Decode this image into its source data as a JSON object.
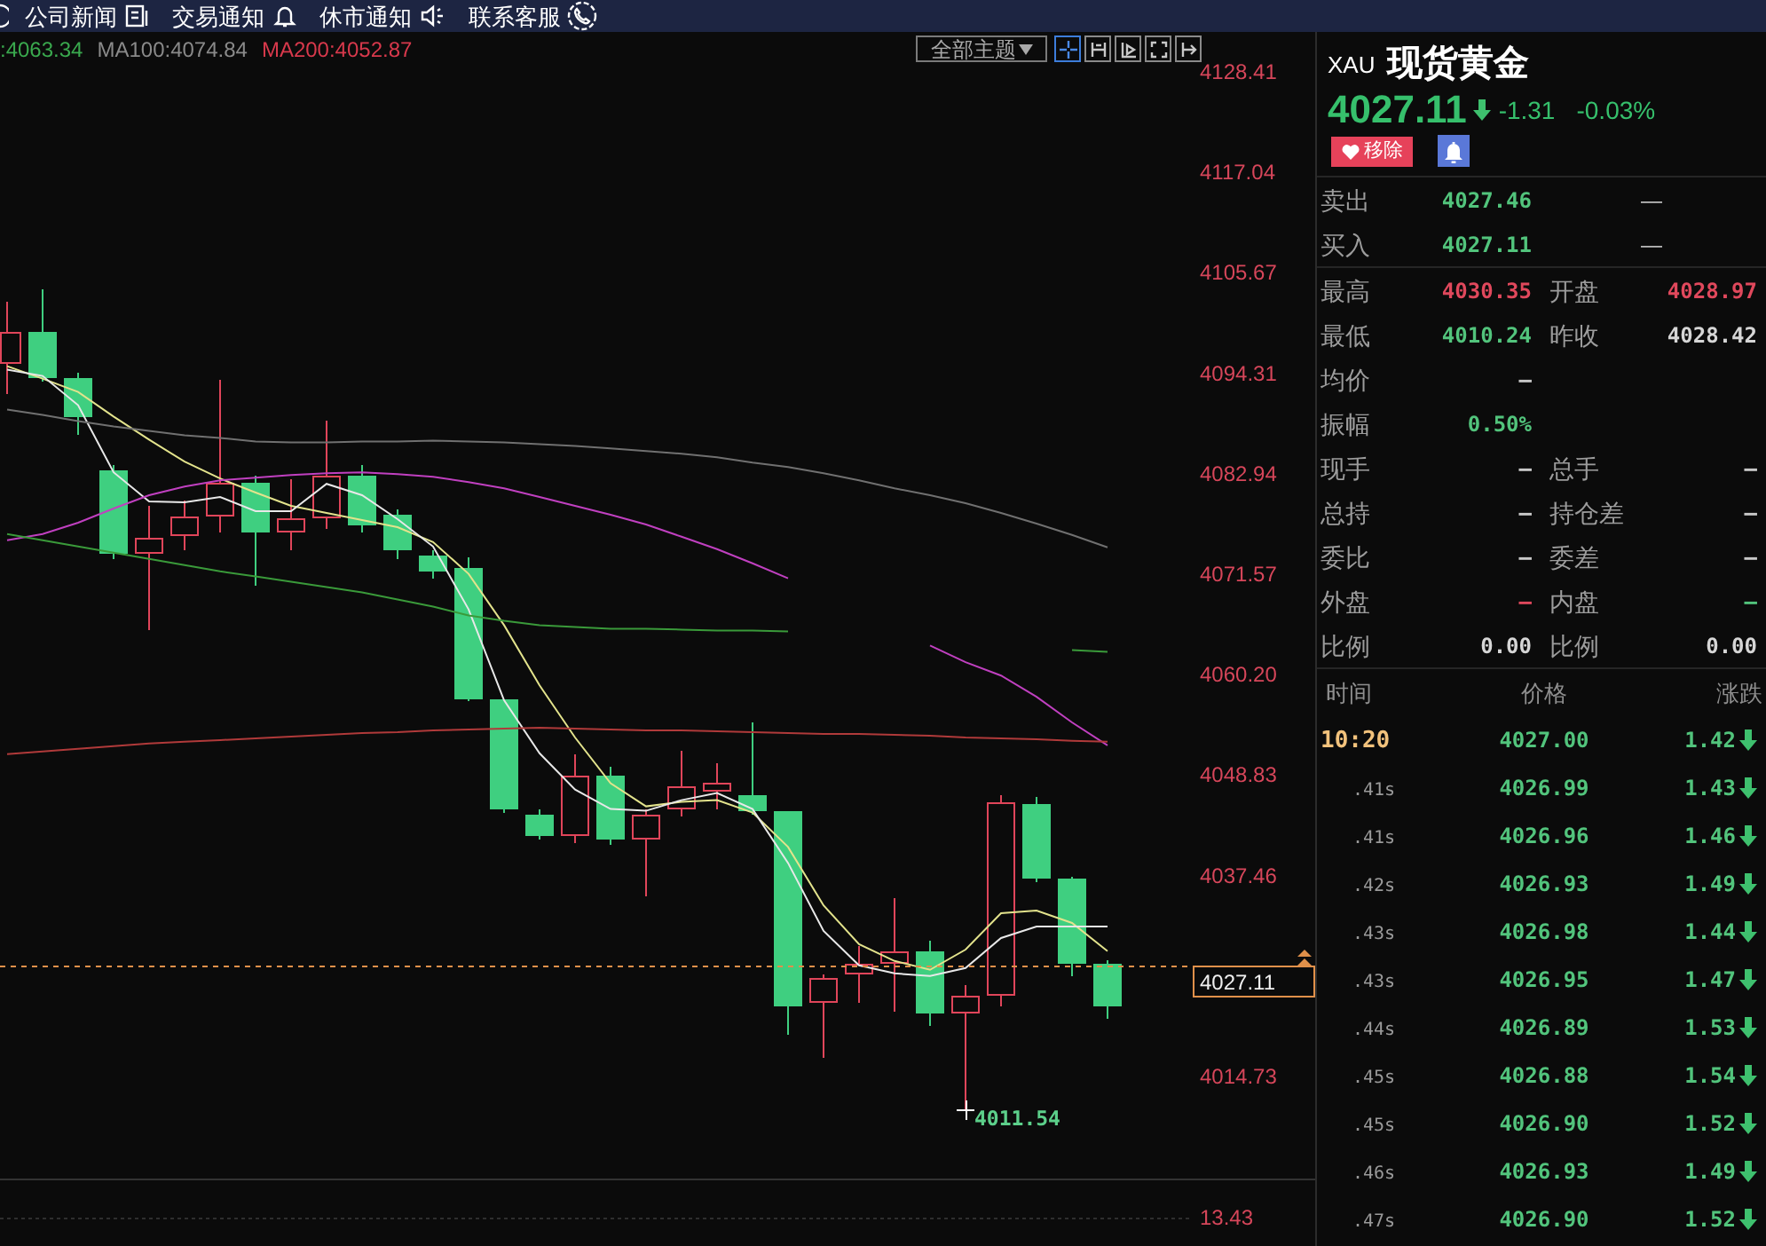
{
  "top_bar": {
    "items": [
      {
        "label": "公司新闻"
      },
      {
        "label": "交易通知"
      },
      {
        "label": "休市通知"
      },
      {
        "label": "联系客服"
      }
    ]
  },
  "chart": {
    "legend": [
      {
        "text": ":4063.34",
        "color": "#3aa94e"
      },
      {
        "text": "MA100:4074.84",
        "color": "#8a8a8a"
      },
      {
        "text": "MA200:4052.87",
        "color": "#d8394c"
      }
    ],
    "theme_select": {
      "value": "全部主题"
    },
    "tools": [
      {
        "kind": "crosshair",
        "selected": true
      },
      {
        "kind": "range",
        "selected": false
      },
      {
        "kind": "step",
        "selected": false
      },
      {
        "kind": "fullscreen",
        "selected": false
      },
      {
        "kind": "exit",
        "selected": false
      }
    ],
    "chart_data": {
      "type": "line",
      "ylim": [
        4014.73,
        4128.41
      ],
      "yticks": [
        4128.41,
        4117.04,
        4105.67,
        4094.31,
        4082.94,
        4071.57,
        {
          "value": 4060.2,
          "label": "4060.20"
        },
        4048.83,
        4037.46,
        4014.73
      ],
      "ref_lines": [
        {
          "axis": "y",
          "value": 4027.11,
          "label": "4027.11",
          "color": "#e0904a"
        }
      ],
      "series": [
        {
          "color": "#e3e38c",
          "values": [
            4095.0,
            4093.6,
            4092.1,
            4089.3,
            4086.7,
            4084.2,
            4082.3,
            4080.7,
            4079.2,
            4078.4,
            4077.6,
            4076.8,
            4075.1,
            4071.5,
            4065.7,
            4058.9,
            4053.0,
            4047.8,
            4045.2,
            4045.7,
            4045.9,
            4044.5,
            4040.6,
            4034.0,
            4029.6,
            4027.7,
            4026.7,
            4029.0,
            4033.1,
            4033.4,
            4032.0,
            4028.8
          ]
        },
        {
          "color": "#e8e8e8",
          "values": [
            4094.6,
            4093.9,
            4090.6,
            4083.0,
            4079.7,
            4079.6,
            4080.2,
            4078.6,
            4078.6,
            4081.7,
            4080.4,
            4077.7,
            4074.6,
            4067.5,
            4057.2,
            4051.2,
            4047.1,
            4044.9,
            4044.7,
            4045.9,
            4046.7,
            4044.9,
            4038.8,
            4031.1,
            4027.2,
            4026.3,
            4026.0,
            4026.9,
            4030.3,
            4031.6,
            4031.6,
            4031.6
          ]
        },
        {
          "color": "#c040c0",
          "values": [
            4075.3,
            4076.0,
            4077.3,
            4078.9,
            4080.4,
            4081.4,
            4082.1,
            4082.4,
            4082.7,
            4082.9,
            4083.0,
            4082.8,
            4082.5,
            4081.9,
            4081.2,
            4080.2,
            4079.2,
            4078.2,
            4077.1,
            4075.7,
            4074.3,
            4072.7,
            4071.0,
            null,
            null,
            null,
            4063.4,
            4061.5,
            4060.0,
            4057.6,
            4054.7,
            4052.1
          ]
        },
        {
          "color": "#3a9a3a",
          "values": [
            4076.0,
            4075.3,
            4074.6,
            4073.9,
            4073.2,
            4072.5,
            4071.8,
            4071.2,
            4070.6,
            4070.0,
            4069.4,
            4068.6,
            4067.8,
            4066.8,
            4066.2,
            4065.7,
            4065.5,
            4065.3,
            4065.3,
            4065.2,
            4065.1,
            4065.1,
            4065.0,
            null,
            null,
            null,
            null,
            null,
            null,
            null,
            4062.9,
            4062.7
          ]
        },
        {
          "color": "#707070",
          "values": [
            4090.1,
            4089.5,
            4088.8,
            4088.2,
            4087.7,
            4087.2,
            4086.9,
            4086.5,
            4086.4,
            4086.4,
            4086.5,
            4086.5,
            4086.6,
            4086.5,
            4086.4,
            4086.2,
            4086.0,
            4085.7,
            4085.4,
            4085.1,
            4084.7,
            4084.1,
            4083.6,
            4082.9,
            4082.1,
            4081.2,
            4080.4,
            4079.5,
            4078.4,
            4077.2,
            4075.9,
            4074.5
          ]
        },
        {
          "color": "#b03a3a",
          "values": [
            4051.1,
            4051.4,
            4051.7,
            4052.0,
            4052.3,
            4052.5,
            4052.7,
            4052.9,
            4053.1,
            4053.3,
            4053.5,
            4053.6,
            4053.8,
            4053.9,
            4054.0,
            4054.1,
            4054.0,
            4053.9,
            4053.8,
            4053.8,
            4053.7,
            4053.6,
            4053.5,
            4053.4,
            4053.4,
            4053.3,
            4053.2,
            4053.0,
            4052.9,
            4052.8,
            4052.6,
            4052.5
          ]
        }
      ]
    },
    "low_label": "4011.54",
    "sub_axis": [
      "13.43"
    ]
  },
  "quote": {
    "symbol": "XAU",
    "name": "现货黄金",
    "price": "4027.11",
    "falling": true,
    "change": "-1.31",
    "change_percent": "-0.03%",
    "remove_button": {
      "label": "移除"
    },
    "bid_ask": [
      {
        "label": "卖出",
        "price": "4027.46",
        "color": "#52c47c",
        "volume": "—"
      },
      {
        "label": "买入",
        "price": "4027.11",
        "color": "#52c47c",
        "volume": "—"
      }
    ],
    "stats": [
      {
        "cells": [
          {
            "label": "最高",
            "value": "4030.35",
            "color": "#e0485c"
          },
          {
            "label": "开盘",
            "value": "4028.97",
            "color": "#e0485c"
          }
        ]
      },
      {
        "cells": [
          {
            "label": "最低",
            "value": "4010.24",
            "color": "#52c47c"
          },
          {
            "label": "昨收",
            "value": "4028.42",
            "color": "#d6d6d6"
          }
        ]
      },
      {
        "cells": [
          {
            "label": "均价",
            "value": "—",
            "color": "#c8c8c8"
          }
        ]
      },
      {
        "cells": [
          {
            "label": "振幅",
            "value": "0.50%",
            "color": "#52c47c"
          }
        ]
      },
      {
        "cells": [
          {
            "label": "现手",
            "value": "—",
            "color": "#c8c8c8"
          },
          {
            "label": "总手",
            "value": "—",
            "color": "#c8c8c8"
          }
        ]
      },
      {
        "cells": [
          {
            "label": "总持",
            "value": "—",
            "color": "#c8c8c8"
          },
          {
            "label": "持仓差",
            "value": "—",
            "color": "#c8c8c8"
          }
        ]
      },
      {
        "cells": [
          {
            "label": "委比",
            "value": "—",
            "color": "#c8c8c8"
          },
          {
            "label": "委差",
            "value": "—",
            "color": "#c8c8c8"
          }
        ]
      },
      {
        "cells": [
          {
            "label": "外盘",
            "value": "—",
            "color": "#e0485c"
          },
          {
            "label": "内盘",
            "value": "—",
            "color": "#52c47c"
          }
        ]
      },
      {
        "cells": [
          {
            "label": "比例",
            "value": "0.00",
            "color": "#d6d6d6"
          },
          {
            "label": "比例",
            "value": "0.00",
            "color": "#d6d6d6"
          }
        ]
      }
    ]
  },
  "ticks": {
    "columns": [
      "时间",
      "价格",
      "涨跌"
    ],
    "rows": [
      {
        "time": "10:20",
        "kind": "minute",
        "price": "4027.00",
        "change": "1.42",
        "falling": true
      },
      {
        "time": ".41s",
        "kind": "second",
        "price": "4026.99",
        "change": "1.43",
        "falling": true
      },
      {
        "time": ".41s",
        "kind": "second",
        "price": "4026.96",
        "change": "1.46",
        "falling": true
      },
      {
        "time": ".42s",
        "kind": "second",
        "price": "4026.93",
        "change": "1.49",
        "falling": true
      },
      {
        "time": ".43s",
        "kind": "second",
        "price": "4026.98",
        "change": "1.44",
        "falling": true
      },
      {
        "time": ".43s",
        "kind": "second",
        "price": "4026.95",
        "change": "1.47",
        "falling": true
      },
      {
        "time": ".44s",
        "kind": "second",
        "price": "4026.89",
        "change": "1.53",
        "falling": true
      },
      {
        "time": ".45s",
        "kind": "second",
        "price": "4026.88",
        "change": "1.54",
        "falling": true
      },
      {
        "time": ".45s",
        "kind": "second",
        "price": "4026.90",
        "change": "1.52",
        "falling": true
      },
      {
        "time": ".46s",
        "kind": "second",
        "price": "4026.93",
        "change": "1.49",
        "falling": true
      },
      {
        "time": ".47s",
        "kind": "second",
        "price": "4026.90",
        "change": "1.52",
        "falling": true
      }
    ]
  }
}
